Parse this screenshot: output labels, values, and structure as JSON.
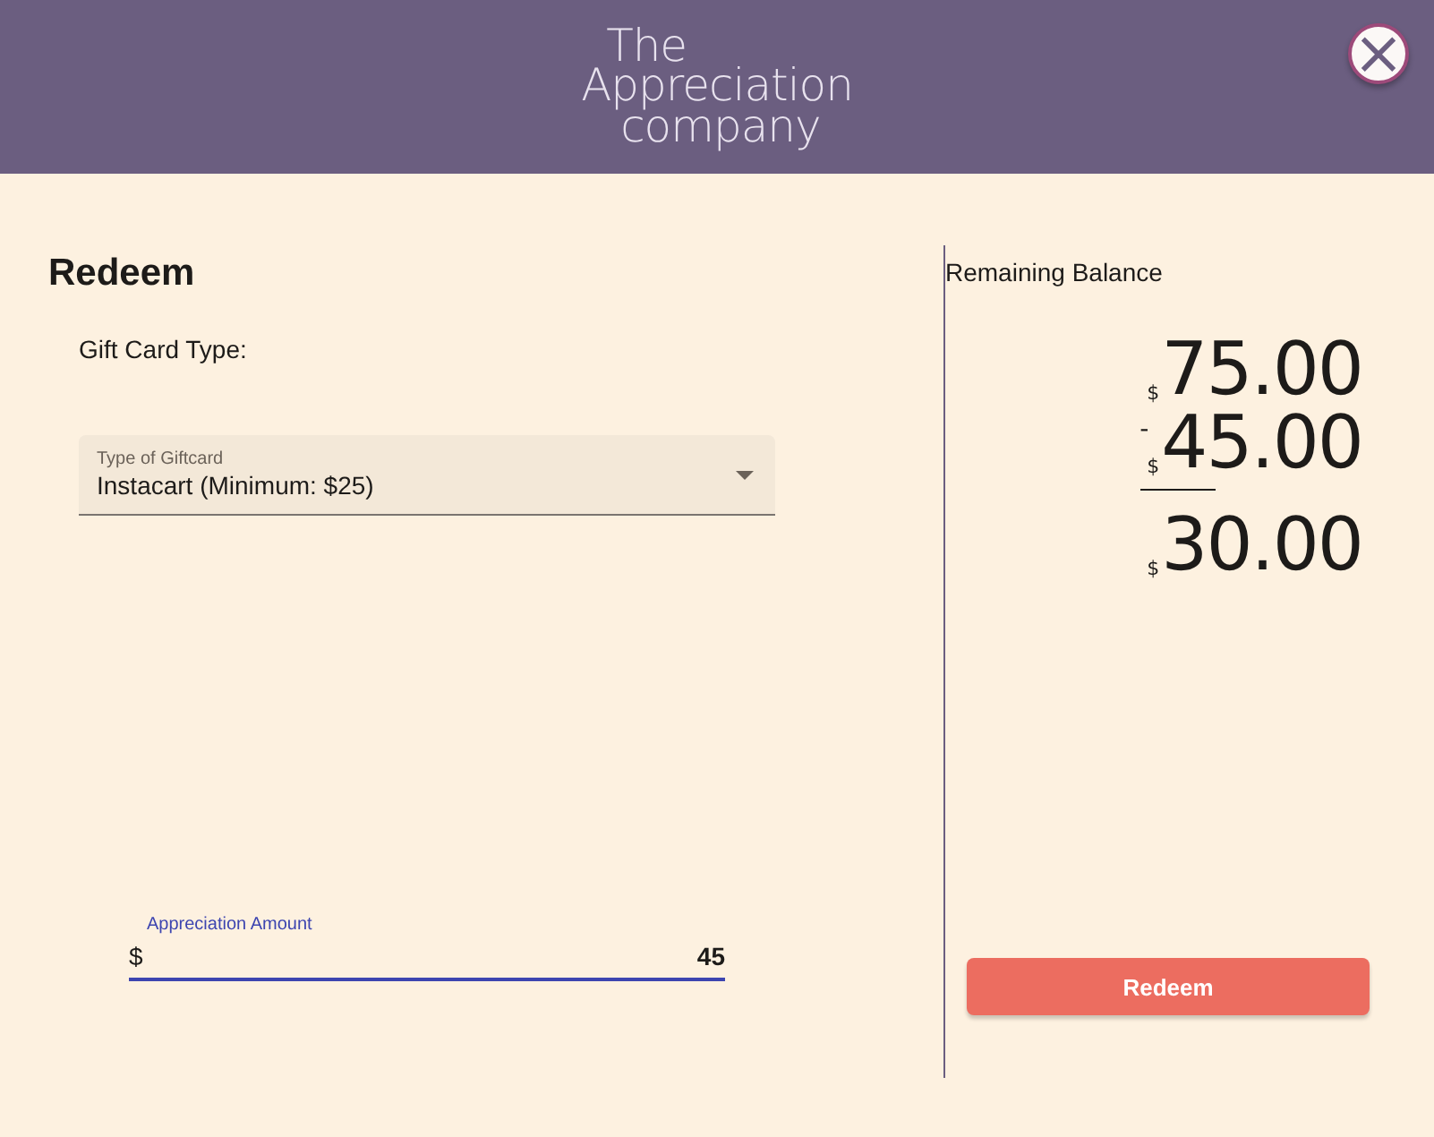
{
  "header": {
    "logo_lines": [
      "The",
      "Appreciation",
      "company"
    ]
  },
  "close_button": {
    "glyph": "×"
  },
  "form": {
    "title": "Redeem",
    "gift_card_label": "Gift Card Type:",
    "select": {
      "label": "Type of Giftcard",
      "value": "Instacart (Minimum: $25)"
    },
    "amount_field": {
      "label": "Appreciation Amount",
      "prefix": "$",
      "value": "45",
      "focused": true
    }
  },
  "balance": {
    "title": "Remaining Balance",
    "lines": [
      {
        "currency": "$",
        "amount": "75.00"
      },
      {
        "operator": "-",
        "currency": "$",
        "amount": "45.00"
      },
      {
        "currency": "$",
        "amount": "30.00",
        "total": true
      }
    ]
  },
  "redeem_button": {
    "label": "Redeem"
  }
}
